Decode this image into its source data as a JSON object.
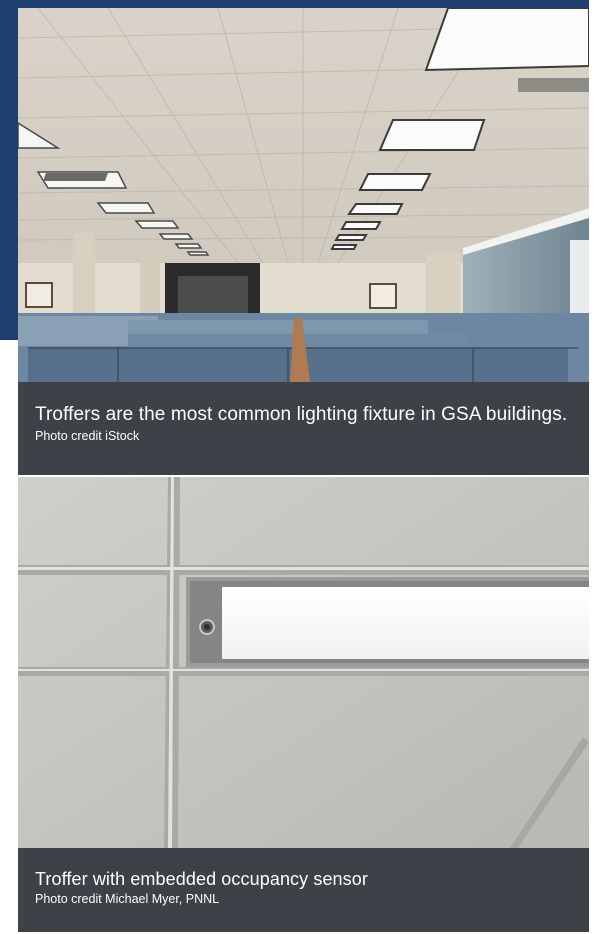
{
  "figures": [
    {
      "image_alt": "open-plan office with rows of cubicles under ceiling troffers",
      "caption": "Troffers are the most common lighting fixture in GSA buildings.",
      "credit": "Photo credit iStock"
    },
    {
      "image_alt": "close-up of ceiling tiles and a troffer with an embedded sensor",
      "caption": "Troffer with embedded occupancy sensor",
      "credit": "Photo credit Michael Myer, PNNL"
    }
  ],
  "colors": {
    "accent_band": "#1f3f6e",
    "caption_background": "#3d4148",
    "caption_text": "#ffffff"
  }
}
